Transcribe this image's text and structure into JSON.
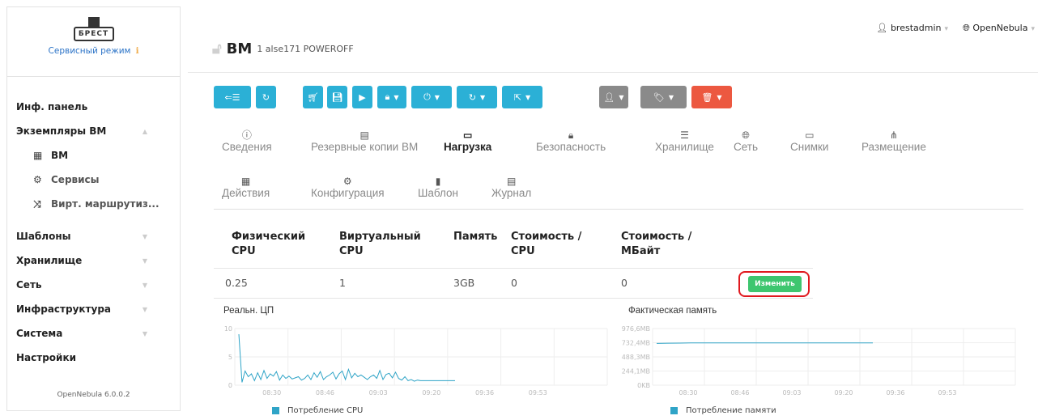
{
  "brand": {
    "logo_text": "БРЕСТ",
    "service_mode": "Сервисный режим",
    "version": "OpenNebula 6.0.0.2"
  },
  "sidebar": {
    "items": [
      {
        "label": "Инф. панель"
      },
      {
        "label": "Экземпляры ВМ"
      },
      {
        "label": "ВМ",
        "icon": "grid-icon"
      },
      {
        "label": "Сервисы",
        "icon": "services-icon"
      },
      {
        "label": "Вирт. маршрутиз...",
        "icon": "router-icon"
      },
      {
        "label": "Шаблоны"
      },
      {
        "label": "Хранилище"
      },
      {
        "label": "Сеть"
      },
      {
        "label": "Инфраструктура"
      },
      {
        "label": "Система"
      },
      {
        "label": "Настройки"
      }
    ]
  },
  "header": {
    "vm_label": "ВМ",
    "vm_meta": "1 alse171 POWEROFF",
    "user": "brestadmin",
    "zone": "OpenNebula"
  },
  "tabs": {
    "info": "Сведения",
    "backups": "Резервные копии ВМ",
    "capacity": "Нагрузка",
    "security": "Безопасность",
    "storage": "Хранилище",
    "network": "Сеть",
    "snapshots": "Снимки",
    "placement": "Размещение",
    "actions": "Действия",
    "conf": "Конфигурация",
    "template": "Шаблон",
    "log": "Журнал"
  },
  "capacity": {
    "headers": {
      "pcpu_1": "Физический",
      "pcpu_2": "CPU",
      "vcpu_1": "Виртуальный",
      "vcpu_2": "CPU",
      "mem": "Память",
      "cost_cpu_1": "Стоимость /",
      "cost_cpu_2": "CPU",
      "cost_mb_1": "Стоимость /",
      "cost_mb_2": "МБайт"
    },
    "row": {
      "pcpu": "0.25",
      "vcpu": "1",
      "mem": "3GB",
      "cost_cpu": "0",
      "cost_mb": "0"
    },
    "edit_label": "Изменить"
  },
  "graphs": {
    "cpu": {
      "title": "Реальн. ЦП",
      "legend": "Потребление CPU"
    },
    "mem": {
      "title": "Фактическая память",
      "legend": "Потребление памяти"
    }
  },
  "chart_data": [
    {
      "type": "line",
      "title": "Реальн. ЦП",
      "y_ticks": [
        "10",
        "5",
        "0"
      ],
      "ylim": [
        0,
        10
      ],
      "x_ticks": [
        "08:30",
        "08:46",
        "09:03",
        "09:20",
        "09:36",
        "09:53"
      ],
      "series": [
        {
          "name": "Потребление CPU",
          "color": "#2fa4c7",
          "values": [
            9,
            0.5,
            2.5,
            1.5,
            2,
            0.8,
            2.2,
            1,
            2.6,
            1.2,
            2,
            1.6,
            2.4,
            0.9,
            1.8,
            1.2,
            1.6,
            1.1,
            1.3,
            1.5,
            0.9,
            1.2,
            1.8,
            1,
            2.2,
            1.4,
            2.4,
            1,
            1.5,
            1.8,
            2.3,
            1.1,
            2,
            2.5,
            1,
            2.8,
            1.3,
            2.1,
            1.5,
            1.8,
            1.4,
            1,
            1.5,
            1.8,
            1.2,
            2.6,
            1,
            1.9,
            2.1,
            1.3,
            2.3,
            1.2,
            0.9,
            1.5,
            0.8,
            1,
            0.7,
            0.9,
            0.8,
            0.8,
            0.8,
            0.8,
            0.8,
            0.8,
            0.8,
            0.8,
            0.8,
            0.8,
            0.8,
            0.8
          ]
        }
      ]
    },
    {
      "type": "line",
      "title": "Фактическая память",
      "y_ticks": [
        "976,6MB",
        "732,4MB",
        "488,3MB",
        "244,1MB",
        "0KB"
      ],
      "ylim": [
        0,
        976.6
      ],
      "x_ticks": [
        "08:30",
        "08:46",
        "09:03",
        "09:20",
        "09:36",
        "09:53"
      ],
      "series": [
        {
          "name": "Потребление памяти",
          "color": "#2fa4c7",
          "values": [
            720,
            724,
            726,
            728,
            728,
            728,
            728,
            728,
            728,
            728,
            728,
            728,
            728,
            728,
            728,
            728,
            728,
            728,
            728,
            728
          ]
        }
      ]
    }
  ]
}
